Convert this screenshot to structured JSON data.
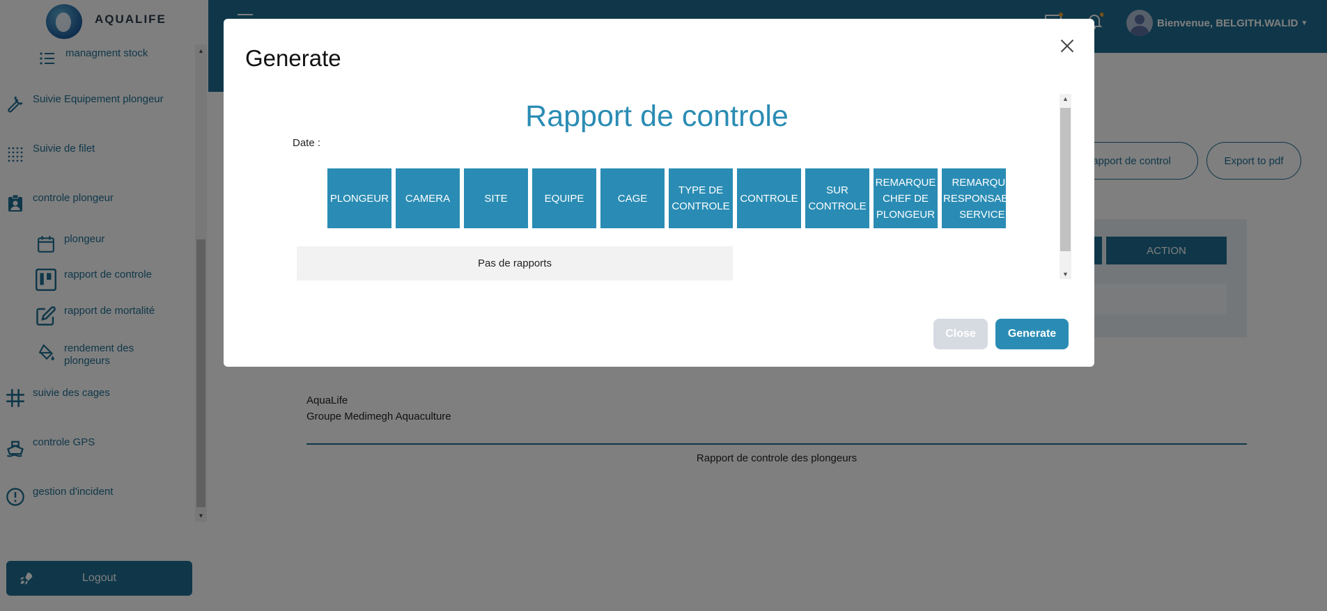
{
  "app": {
    "brand": "AQUALIFE"
  },
  "sidebar": {
    "items": [
      {
        "label": "managment stock",
        "icon": "list-icon"
      },
      {
        "label": "Suivie Equipement plongeur",
        "icon": "wrench-icon"
      },
      {
        "label": "Suivie de filet",
        "icon": "grid-dots-icon"
      },
      {
        "label": "controle plongeur",
        "icon": "badge-icon"
      },
      {
        "label": "plongeur",
        "icon": "calendar-icon"
      },
      {
        "label": "rapport de controle",
        "icon": "kanban-icon"
      },
      {
        "label": "rapport de mortalité",
        "icon": "edit-icon"
      },
      {
        "label": "rendement des plongeurs",
        "icon": "paint-bucket-icon"
      },
      {
        "label": "suivie des cages",
        "icon": "hash-grid-icon"
      },
      {
        "label": "controle GPS",
        "icon": "ship-icon"
      },
      {
        "label": "gestion d'incident",
        "icon": "alert-circle-icon"
      }
    ],
    "logout_label": "Logout"
  },
  "header": {
    "user_greeting": "Bienvenue, BELGITH.WALID"
  },
  "page": {
    "btn_rapport": "apport de control",
    "btn_export": "Export to pdf",
    "action_header": "ACTION",
    "company_name": "AquaLife",
    "company_group": "Groupe Medimegh Aquaculture",
    "report_footer_title": "Rapport de controle des plongeurs"
  },
  "modal": {
    "title": "Generate",
    "report_title": "Rapport de controle",
    "date_label": "Date :",
    "columns": [
      "PLONGEUR",
      "CAMERA",
      "SITE",
      "EQUIPE",
      "CAGE",
      "TYPE DE CONTROLE",
      "CONTROLE",
      "SUR CONTROLE",
      "REMARQUE CHEF DE PLONGEUR",
      "REMARQUE RESPONSABLE SERVICE"
    ],
    "empty_message": "Pas de rapports",
    "close_label": "Close",
    "generate_label": "Generate"
  },
  "colors": {
    "primary": "#1f6f93",
    "accent": "#2a8cb4"
  }
}
